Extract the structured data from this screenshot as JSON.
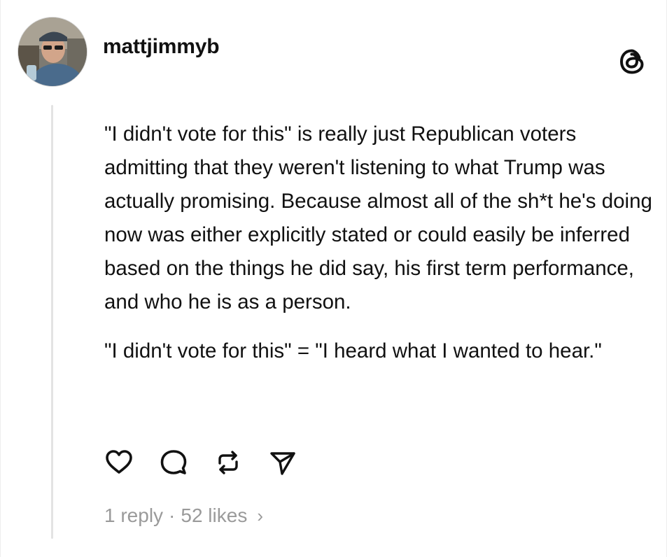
{
  "post": {
    "username": "mattjimmyb",
    "paragraphs": [
      "\"I didn't vote for this\" is really just Republican voters admitting that they weren't listening to what Trump was actually promising. Because almost all of the sh*t he's doing now was either explicitly stated or could easily be inferred based on the things he did say, his first term performance, and who he is as a person.",
      "\"I didn't vote for this\" = \"I heard what I wanted to hear.\""
    ],
    "stats": {
      "replies": "1 reply",
      "separator": "·",
      "likes": "52 likes",
      "chevron": "›"
    }
  },
  "icons": {
    "logo": "threads-logo-icon",
    "like": "heart-icon",
    "comment": "comment-bubble-icon",
    "repost": "repost-icon",
    "share": "send-icon"
  },
  "colors": {
    "text": "#111111",
    "muted": "#9a9a9a",
    "thread_line": "#e3e3e3"
  }
}
